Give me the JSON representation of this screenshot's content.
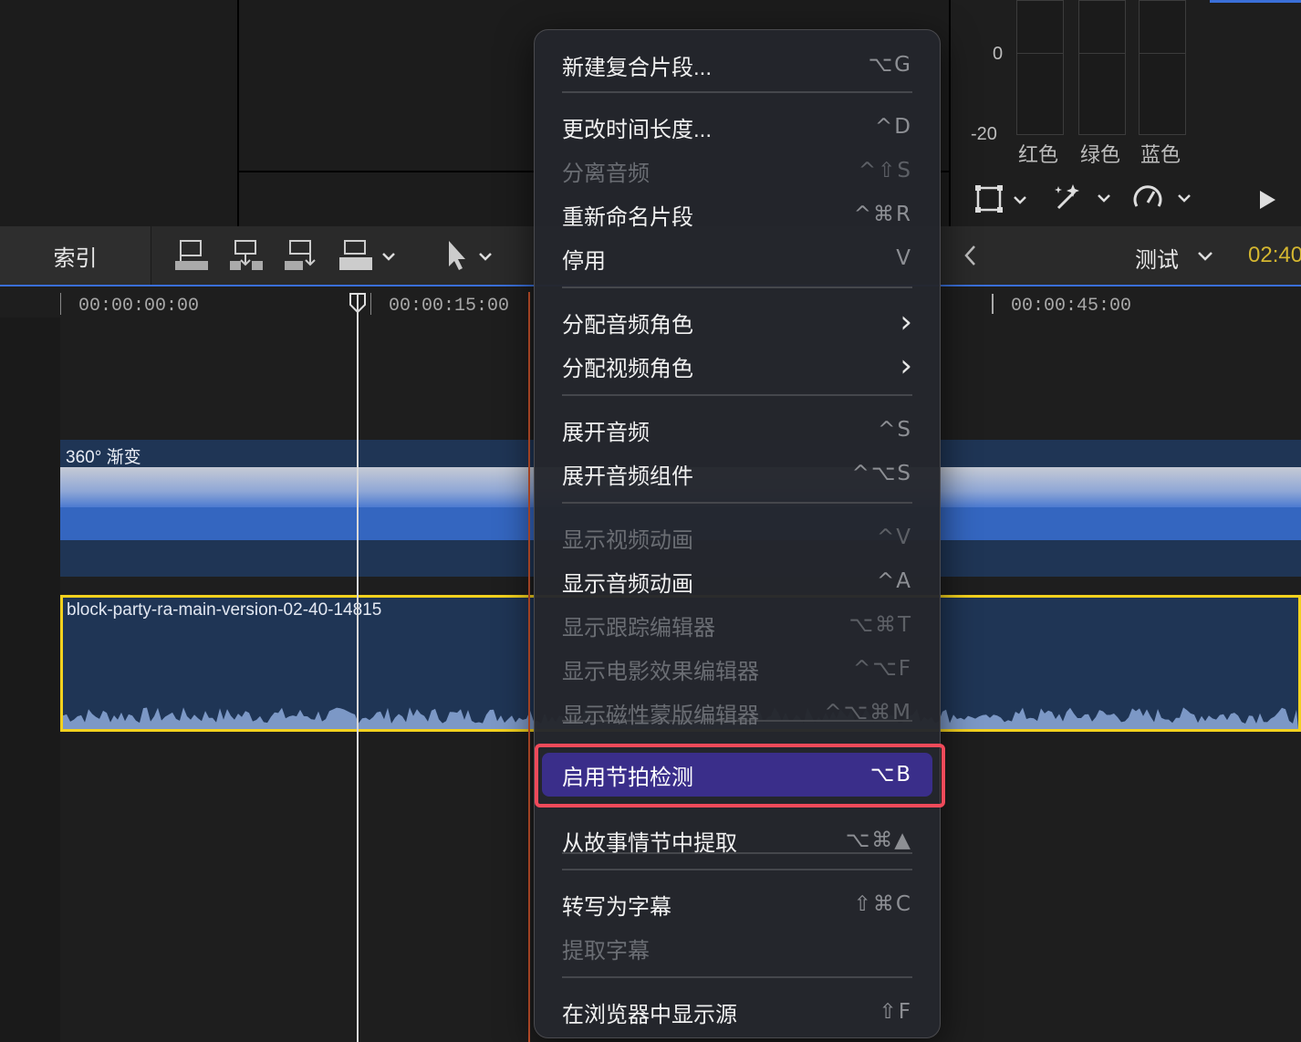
{
  "scopes": {
    "scale": [
      "0",
      "-20"
    ],
    "channels": [
      "红色",
      "绿色",
      "蓝色"
    ]
  },
  "toolbar": {
    "index_label": "索引",
    "project_name": "测试",
    "timecode": "02:40"
  },
  "ruler": {
    "labels": [
      "00:00:00:00",
      "00:00:15:00",
      "00:00:45:00"
    ]
  },
  "timeline": {
    "title_clip": "360° 渐变",
    "audio_clip": "block-party-ra-main-version-02-40-14815"
  },
  "menu": {
    "items": [
      {
        "label": "新建复合片段...",
        "shortcut": "⌥G",
        "enabled": true
      },
      {
        "label": "更改时间长度...",
        "shortcut": "^D",
        "enabled": true
      },
      {
        "label": "分离音频",
        "shortcut": "^⇧S",
        "enabled": false
      },
      {
        "label": "重新命名片段",
        "shortcut": "^⌘R",
        "enabled": true
      },
      {
        "label": "停用",
        "shortcut": "V",
        "enabled": true
      },
      {
        "label": "分配音频角色",
        "shortcut": "",
        "enabled": true,
        "submenu": true
      },
      {
        "label": "分配视频角色",
        "shortcut": "",
        "enabled": true,
        "submenu": true
      },
      {
        "label": "展开音频",
        "shortcut": "^S",
        "enabled": true
      },
      {
        "label": "展开音频组件",
        "shortcut": "^⌥S",
        "enabled": true
      },
      {
        "label": "显示视频动画",
        "shortcut": "^V",
        "enabled": false
      },
      {
        "label": "显示音频动画",
        "shortcut": "^A",
        "enabled": true
      },
      {
        "label": "显示跟踪编辑器",
        "shortcut": "⌥⌘T",
        "enabled": false
      },
      {
        "label": "显示电影效果编辑器",
        "shortcut": "^⌥F",
        "enabled": false
      },
      {
        "label": "显示磁性蒙版编辑器",
        "shortcut": "^⌥⌘M",
        "enabled": false
      },
      {
        "label": "启用节拍检测",
        "shortcut": "⌥B",
        "enabled": true,
        "highlighted": true
      },
      {
        "label": "从故事情节中提取",
        "shortcut": "⌥⌘▲",
        "enabled": true
      },
      {
        "label": "转写为字幕",
        "shortcut": "⇧⌘C",
        "enabled": true
      },
      {
        "label": "提取字幕",
        "shortcut": "",
        "enabled": false
      },
      {
        "label": "在浏览器中显示源",
        "shortcut": "⇧F",
        "enabled": true
      }
    ]
  }
}
